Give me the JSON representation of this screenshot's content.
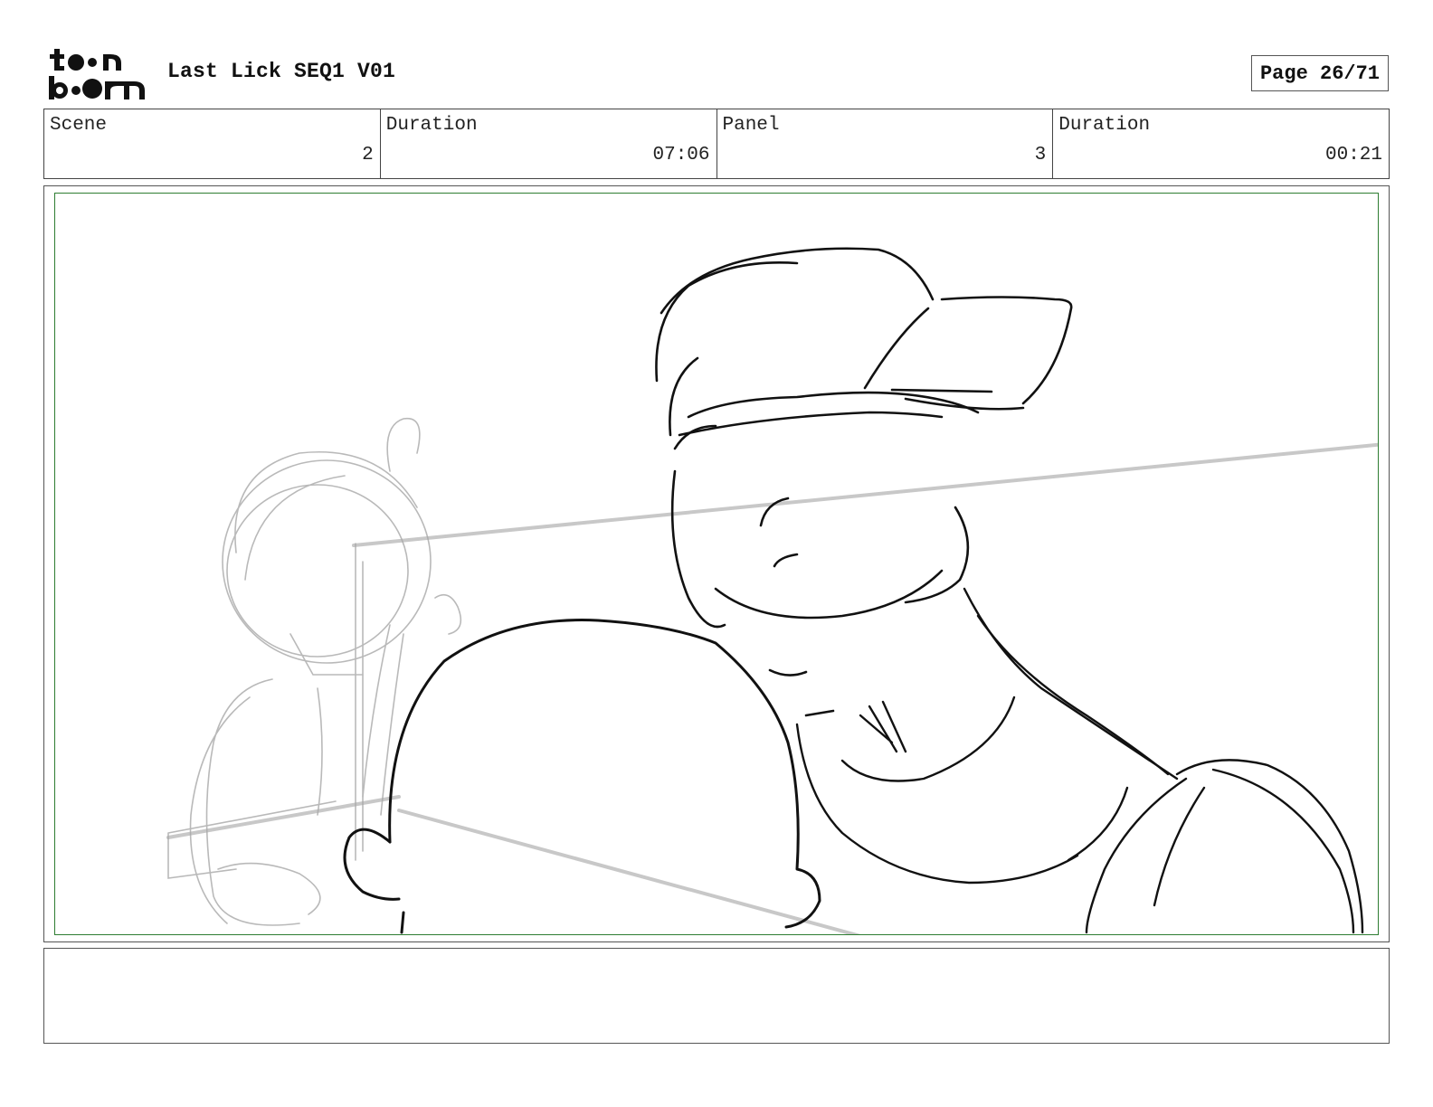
{
  "header": {
    "logo_icon": "toon-boom-logo",
    "logo_text": "toon boom",
    "title": "Last Lick SEQ1 V01",
    "page_label": "Page 26/71"
  },
  "info": {
    "scene_label": "Scene",
    "scene_value": "2",
    "scene_duration_label": "Duration",
    "scene_duration_value": "07:06",
    "panel_label": "Panel",
    "panel_value": "3",
    "panel_duration_label": "Duration",
    "panel_duration_value": "00:21"
  },
  "panel": {
    "image_icon": "storyboard-sketch",
    "frame_color": "#2e7d32"
  },
  "notes": {
    "text": ""
  }
}
